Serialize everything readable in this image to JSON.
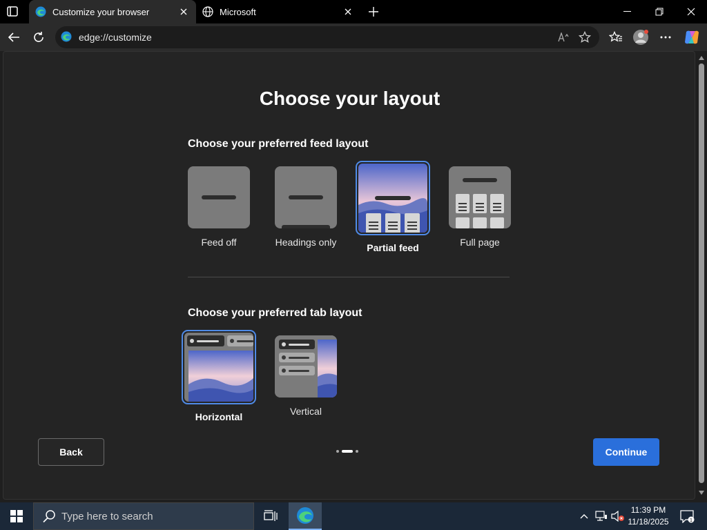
{
  "tabs": [
    {
      "title": "Customize your browser",
      "icon": "edge-icon",
      "active": true
    },
    {
      "title": "Microsoft",
      "icon": "globe-icon",
      "active": false
    }
  ],
  "address": {
    "url": "edge://customize"
  },
  "page": {
    "title": "Choose your layout",
    "feed_section_title": "Choose your preferred feed layout",
    "feed_options": [
      {
        "label": "Feed off",
        "selected": false
      },
      {
        "label": "Headings only",
        "selected": false
      },
      {
        "label": "Partial feed",
        "selected": true
      },
      {
        "label": "Full page",
        "selected": false
      }
    ],
    "tab_section_title": "Choose your preferred tab layout",
    "tab_options": [
      {
        "label": "Horizontal",
        "selected": true
      },
      {
        "label": "Vertical",
        "selected": false
      }
    ],
    "back_label": "Back",
    "continue_label": "Continue",
    "step": {
      "current": 2,
      "total": 3
    }
  },
  "taskbar": {
    "search_placeholder": "Type here to search",
    "time": "11:39 PM",
    "date": "11/18/2025",
    "notification_count": "1"
  },
  "colors": {
    "accent": "#2a6fdb",
    "selection_border": "#4f8be8",
    "page_bg": "#242424",
    "taskbar_bg": "#1b2838"
  }
}
